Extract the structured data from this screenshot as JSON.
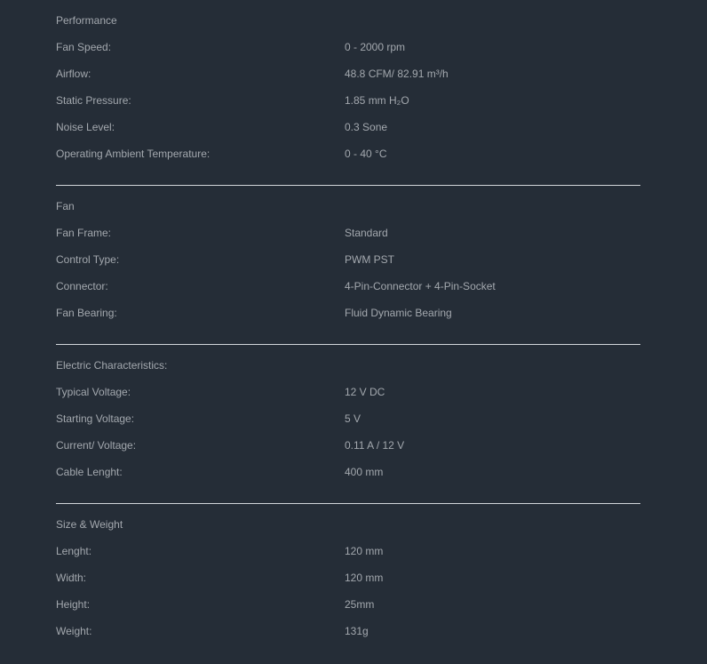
{
  "sections": [
    {
      "title": "Performance",
      "rows": [
        {
          "label": "Fan Speed:",
          "value": "0 - 2000 rpm"
        },
        {
          "label": "Airflow:",
          "value": "48.8 CFM/ 82.91 m³/h"
        },
        {
          "label": "Static Pressure:",
          "value": "1.85 mm H₂O"
        },
        {
          "label": "Noise Level:",
          "value": "0.3 Sone"
        },
        {
          "label": "Operating Ambient Temperature:",
          "value": "0 - 40 °C"
        }
      ]
    },
    {
      "title": "Fan",
      "rows": [
        {
          "label": "Fan Frame:",
          "value": "Standard"
        },
        {
          "label": "Control Type:",
          "value": "PWM PST"
        },
        {
          "label": "Connector:",
          "value": "4-Pin-Connector + 4-Pin-Socket"
        },
        {
          "label": "Fan Bearing:",
          "value": "Fluid Dynamic Bearing"
        }
      ]
    },
    {
      "title": "Electric Characteristics:",
      "rows": [
        {
          "label": "Typical Voltage:",
          "value": "12 V DC"
        },
        {
          "label": "Starting Voltage:",
          "value": "5 V"
        },
        {
          "label": "Current/ Voltage:",
          "value": "0.11 A / 12 V"
        },
        {
          "label": "Cable Lenght:",
          "value": "400 mm"
        }
      ]
    },
    {
      "title": "Size & Weight",
      "rows": [
        {
          "label": "Lenght:",
          "value": "120 mm"
        },
        {
          "label": "Width:",
          "value": "120 mm"
        },
        {
          "label": "Height:",
          "value": "25mm"
        },
        {
          "label": "Weight:",
          "value": "131g"
        }
      ]
    }
  ]
}
